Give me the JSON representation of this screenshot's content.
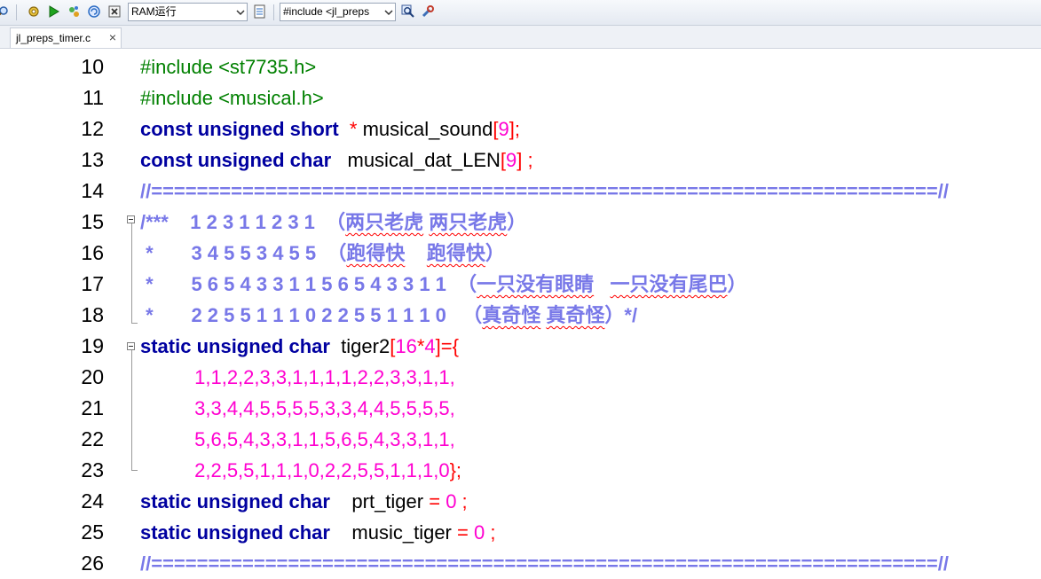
{
  "toolbar": {
    "build_target": "RAM运行",
    "include_select": "#include <jl_preps"
  },
  "tabs": [
    {
      "label": "jl_preps_timer.c",
      "close": "×"
    }
  ],
  "editor": {
    "lines": [
      {
        "no": "10",
        "tokens": [
          {
            "t": "#include <st7735.h>",
            "c": "pp"
          }
        ]
      },
      {
        "no": "11",
        "tokens": [
          {
            "t": "#include <musical.h>",
            "c": "pp"
          }
        ]
      },
      {
        "no": "12",
        "tokens": [
          {
            "t": "const unsigned short ",
            "c": "kw"
          },
          {
            "t": " * ",
            "c": "op"
          },
          {
            "t": "musical_sound",
            "c": "id"
          },
          {
            "t": "[",
            "c": "op"
          },
          {
            "t": "9",
            "c": "num"
          },
          {
            "t": "];",
            "c": "op"
          }
        ]
      },
      {
        "no": "13",
        "tokens": [
          {
            "t": "const unsigned char ",
            "c": "kw"
          },
          {
            "t": "  musical_dat_LEN",
            "c": "id"
          },
          {
            "t": "[",
            "c": "op"
          },
          {
            "t": "9",
            "c": "num"
          },
          {
            "t": "] ;",
            "c": "op"
          }
        ]
      },
      {
        "no": "14",
        "tokens": [
          {
            "t": "//=====================================================================//",
            "c": "cm"
          }
        ]
      },
      {
        "no": "15",
        "tokens": [
          {
            "t": "/***    1 2 3 1 1 2 3 1  （",
            "c": "cm"
          },
          {
            "t": "两只老虎",
            "c": "cm sq"
          },
          {
            "t": " ",
            "c": "cm"
          },
          {
            "t": "两只老虎",
            "c": "cm sq"
          },
          {
            "t": "）",
            "c": "cm"
          }
        ]
      },
      {
        "no": "16",
        "tokens": [
          {
            "t": " *       3 4 5 5 3 4 5 5  （",
            "c": "cm"
          },
          {
            "t": "跑得快",
            "c": "cm sq"
          },
          {
            "t": "    ",
            "c": "cm"
          },
          {
            "t": "跑得快",
            "c": "cm sq"
          },
          {
            "t": "）",
            "c": "cm"
          }
        ]
      },
      {
        "no": "17",
        "tokens": [
          {
            "t": " *       5 6 5 4 3 3 1 1 5 6 5 4 3 3 1 1  （",
            "c": "cm"
          },
          {
            "t": "一只没有眼睛",
            "c": "cm sq"
          },
          {
            "t": "   ",
            "c": "cm"
          },
          {
            "t": "一只没有尾巴",
            "c": "cm sq"
          },
          {
            "t": "）",
            "c": "cm"
          }
        ]
      },
      {
        "no": "18",
        "tokens": [
          {
            "t": " *       2 2 5 5 1 1 1 0 2 2 5 5 1 1 1 0   （",
            "c": "cm"
          },
          {
            "t": "真奇怪",
            "c": "cm sq"
          },
          {
            "t": " ",
            "c": "cm"
          },
          {
            "t": "真奇怪",
            "c": "cm sq"
          },
          {
            "t": "）*/",
            "c": "cm"
          }
        ]
      },
      {
        "no": "19",
        "tokens": [
          {
            "t": "static unsigned char ",
            "c": "kw"
          },
          {
            "t": " tiger2",
            "c": "id"
          },
          {
            "t": "[",
            "c": "op"
          },
          {
            "t": "16",
            "c": "num"
          },
          {
            "t": "*",
            "c": "op"
          },
          {
            "t": "4",
            "c": "num"
          },
          {
            "t": "]={",
            "c": "op"
          }
        ]
      },
      {
        "no": "20",
        "tokens": [
          {
            "t": "          1,1,2,2,3,3,1,1,1,1,2,2,3,3,1,1,",
            "c": "num"
          }
        ]
      },
      {
        "no": "21",
        "tokens": [
          {
            "t": "          3,3,4,4,5,5,5,5,3,3,4,4,5,5,5,5,",
            "c": "num"
          }
        ]
      },
      {
        "no": "22",
        "tokens": [
          {
            "t": "          5,6,5,4,3,3,1,1,5,6,5,4,3,3,1,1,",
            "c": "num"
          }
        ]
      },
      {
        "no": "23",
        "tokens": [
          {
            "t": "          2,2,5,5,1,1,1,0,2,2,5,5,1,1,1,0",
            "c": "num"
          },
          {
            "t": "};",
            "c": "op"
          }
        ]
      },
      {
        "no": "24",
        "tokens": [
          {
            "t": "static unsigned char ",
            "c": "kw"
          },
          {
            "t": "   prt_tiger ",
            "c": "id"
          },
          {
            "t": "= ",
            "c": "op"
          },
          {
            "t": "0",
            "c": "num"
          },
          {
            "t": " ;",
            "c": "op"
          }
        ]
      },
      {
        "no": "25",
        "tokens": [
          {
            "t": "static unsigned char ",
            "c": "kw"
          },
          {
            "t": "   music_tiger ",
            "c": "id"
          },
          {
            "t": "= ",
            "c": "op"
          },
          {
            "t": "0",
            "c": "num"
          },
          {
            "t": " ;",
            "c": "op"
          }
        ]
      },
      {
        "no": "26",
        "tokens": [
          {
            "t": "//=====================================================================//",
            "c": "cm"
          }
        ]
      }
    ]
  }
}
